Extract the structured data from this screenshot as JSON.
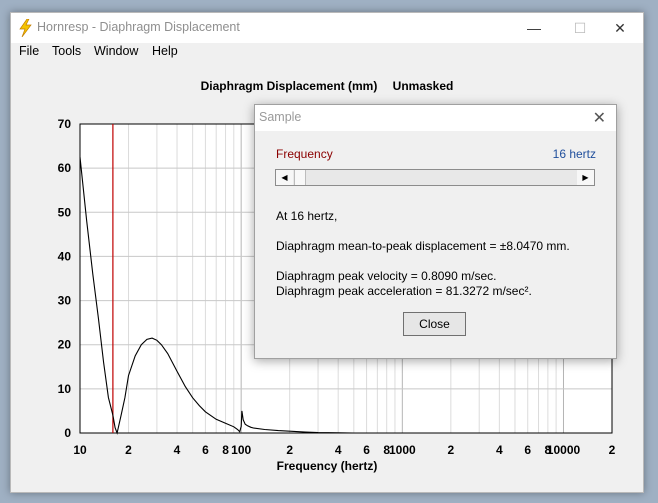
{
  "window": {
    "title": "Hornresp - Diaphragm Displacement",
    "controls": {
      "minimize": "—",
      "maximize": "☐",
      "close": "✕"
    }
  },
  "menu": [
    "File",
    "Tools",
    "Window",
    "Help"
  ],
  "chart": {
    "title": "Diaphragm Displacement (mm)",
    "mode": "Unmasked",
    "xlabel": "Frequency (hertz)"
  },
  "chart_data": {
    "type": "line",
    "title": "Diaphragm Displacement (mm)",
    "xlabel": "Frequency (hertz)",
    "ylabel": "",
    "xscale": "log",
    "xlim": [
      10,
      20000
    ],
    "ylim": [
      0,
      70
    ],
    "yticks": [
      0,
      10,
      20,
      30,
      40,
      50,
      60,
      70
    ],
    "xtick_labels": [
      "10",
      "2",
      "4",
      "6",
      "8",
      "100",
      "2",
      "4",
      "6",
      "8",
      "1000",
      "2",
      "4",
      "6",
      "8",
      "10000",
      "2"
    ],
    "grid": true,
    "marker_frequency": 16,
    "series": [
      {
        "color": "#000000",
        "x": [
          10,
          11,
          12,
          13,
          14,
          15,
          16,
          16.5,
          17,
          18,
          19,
          20,
          22,
          24,
          26,
          28,
          30,
          32,
          35,
          40,
          45,
          50,
          55,
          60,
          70,
          80,
          90,
          95,
          98,
          100,
          101,
          103,
          106,
          110,
          115,
          120,
          140,
          170,
          200,
          250,
          300,
          400,
          500,
          1000,
          2000,
          5000,
          10000
        ],
        "y": [
          62.5,
          48,
          36,
          26,
          16,
          8.05,
          4,
          1.2,
          0,
          4,
          8,
          13,
          17.5,
          20,
          21.2,
          21.5,
          21,
          20,
          18,
          14,
          10.5,
          8,
          6.2,
          4.8,
          3.1,
          2.2,
          1.4,
          0.8,
          0.3,
          1.5,
          5,
          3,
          2,
          1.6,
          1.3,
          1.1,
          0.8,
          0.55,
          0.4,
          0.2,
          0.1,
          0.05,
          0,
          0,
          0,
          0,
          0
        ]
      }
    ]
  },
  "dialog": {
    "title": "Sample",
    "close_glyph": "✕",
    "frequency_label": "Frequency",
    "frequency_value": "16 hertz",
    "line1": "At 16 hertz,",
    "line2": "Diaphragm mean-to-peak displacement = ±8.0470 mm.",
    "line3": "Diaphragm peak velocity = 0.8090 m/sec.",
    "line4": "Diaphragm peak acceleration = 81.3272 m/sec².",
    "close_button": "Close"
  },
  "icons": {
    "app": "lightning-bolt-icon"
  }
}
